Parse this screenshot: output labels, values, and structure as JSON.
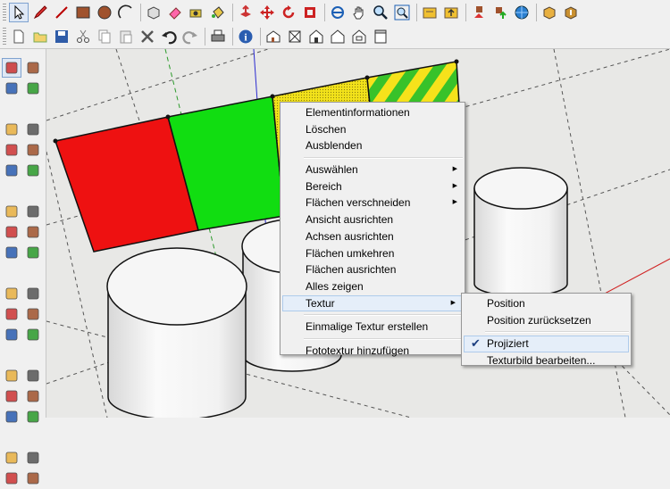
{
  "toolbar": {
    "row1_icons": [
      "select-icon",
      "pencil-icon",
      "line-icon",
      "rectangle-icon",
      "circle-icon",
      "arc-icon",
      "make-component-icon",
      "eraser-icon",
      "tape-measure-icon",
      "paint-bucket-icon",
      "push-pull-icon",
      "move-icon",
      "rotate-icon",
      "offset-icon",
      "orbit-icon",
      "pan-icon",
      "zoom-icon",
      "zoom-extents-icon",
      "get-models-icon",
      "share-model-icon",
      "components-icon",
      "share-component-icon",
      "warehouse-icon",
      "import-icon",
      "export-icon"
    ],
    "row2_icons": [
      "new-icon",
      "open-icon",
      "save-icon",
      "cut-icon",
      "copy-icon",
      "paste-icon",
      "delete-icon",
      "undo-icon",
      "redo-icon",
      "print-icon",
      "model-info-icon",
      "iso-view-icon",
      "top-view-icon",
      "front-view-icon",
      "right-view-icon",
      "back-view-icon",
      "left-view-icon"
    ]
  },
  "left_toolbar_icons": [
    "select-icon",
    "make-component-icon",
    "paint-bucket-icon",
    "eraser-icon",
    "rectangle-icon",
    "line-icon",
    "circle-icon",
    "arc-icon",
    "polygon-icon",
    "freehand-icon",
    "move-icon",
    "push-pull-icon",
    "rotate-icon",
    "follow-me-icon",
    "scale-icon",
    "offset-icon",
    "tape-measure-icon",
    "dimension-icon",
    "protractor-icon",
    "text-icon",
    "axes-icon",
    "3d-text-icon",
    "orbit-icon",
    "pan-icon",
    "zoom-icon",
    "zoom-window-icon",
    "previous-view-icon",
    "zoom-extents-icon",
    "position-camera-icon",
    "look-around-icon",
    "walk-icon",
    "section-plane-icon"
  ],
  "context_menu": {
    "items": [
      {
        "label": "Elementinformationen"
      },
      {
        "label": "Löschen"
      },
      {
        "label": "Ausblenden"
      },
      {
        "label": "Auswählen"
      },
      {
        "label": "Bereich"
      },
      {
        "label": "Flächen verschneiden"
      },
      {
        "label": "Ansicht ausrichten"
      },
      {
        "label": "Achsen ausrichten"
      },
      {
        "label": "Flächen umkehren"
      },
      {
        "label": "Flächen ausrichten"
      },
      {
        "label": "Alles zeigen"
      },
      {
        "label": "Textur"
      },
      {
        "label": "Einmalige Textur erstellen"
      },
      {
        "label": "Fototextur hinzufügen"
      }
    ]
  },
  "submenu": {
    "items": [
      {
        "label": "Position"
      },
      {
        "label": "Position zurücksetzen"
      },
      {
        "label": "Projiziert",
        "checked": true
      },
      {
        "label": "Texturbild bearbeiten..."
      }
    ]
  },
  "colors": {
    "face_red": "#ee1111",
    "face_green": "#11dd11",
    "face_yellow": "#f2e21a",
    "menu_highlight": "#e5eef9"
  }
}
